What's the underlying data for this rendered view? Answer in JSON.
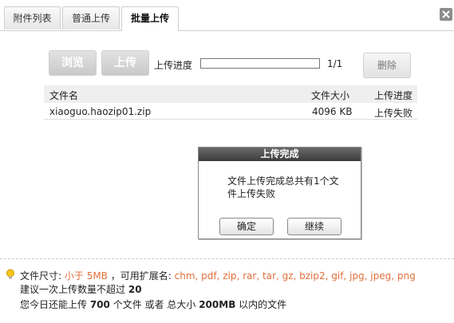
{
  "tabs": [
    {
      "label": "附件列表"
    },
    {
      "label": "普通上传"
    },
    {
      "label": "批量上传"
    }
  ],
  "toolbar": {
    "browse_label": "浏览",
    "upload_label": "上传",
    "progress_label": "上传进度",
    "progress_fraction": 0,
    "progress_count": "1/1",
    "delete_label": "删除"
  },
  "table": {
    "headers": [
      "文件名",
      "文件大小",
      "上传进度"
    ],
    "rows": [
      {
        "name": "xiaoguo.haozip01.zip",
        "size": "4096 KB",
        "status": "上传失败"
      }
    ]
  },
  "dialog": {
    "title": "上传完成",
    "message": "文件上传完成总共有1个文件上传失败",
    "ok_label": "确定",
    "continue_label": "继续"
  },
  "info": {
    "size_label": "文件尺寸:",
    "size_value": "小于 5MB",
    "ext_label": "，可用扩展名:",
    "ext_value": "chm, pdf, zip, rar, tar, gz, bzip2, gif, jpg, jpeg, png",
    "line2_prefix": "建议一次上传数量不超过",
    "line2_count": "20",
    "line3_a": "您今日还能上传",
    "line3_count": "700",
    "line3_b": "个文件 或者 总大小",
    "line3_size": "200MB",
    "line3_c": "以内的文件"
  },
  "colors": {
    "accent": "#e0703b",
    "dialog_title_bg": "#4a4a4a"
  }
}
